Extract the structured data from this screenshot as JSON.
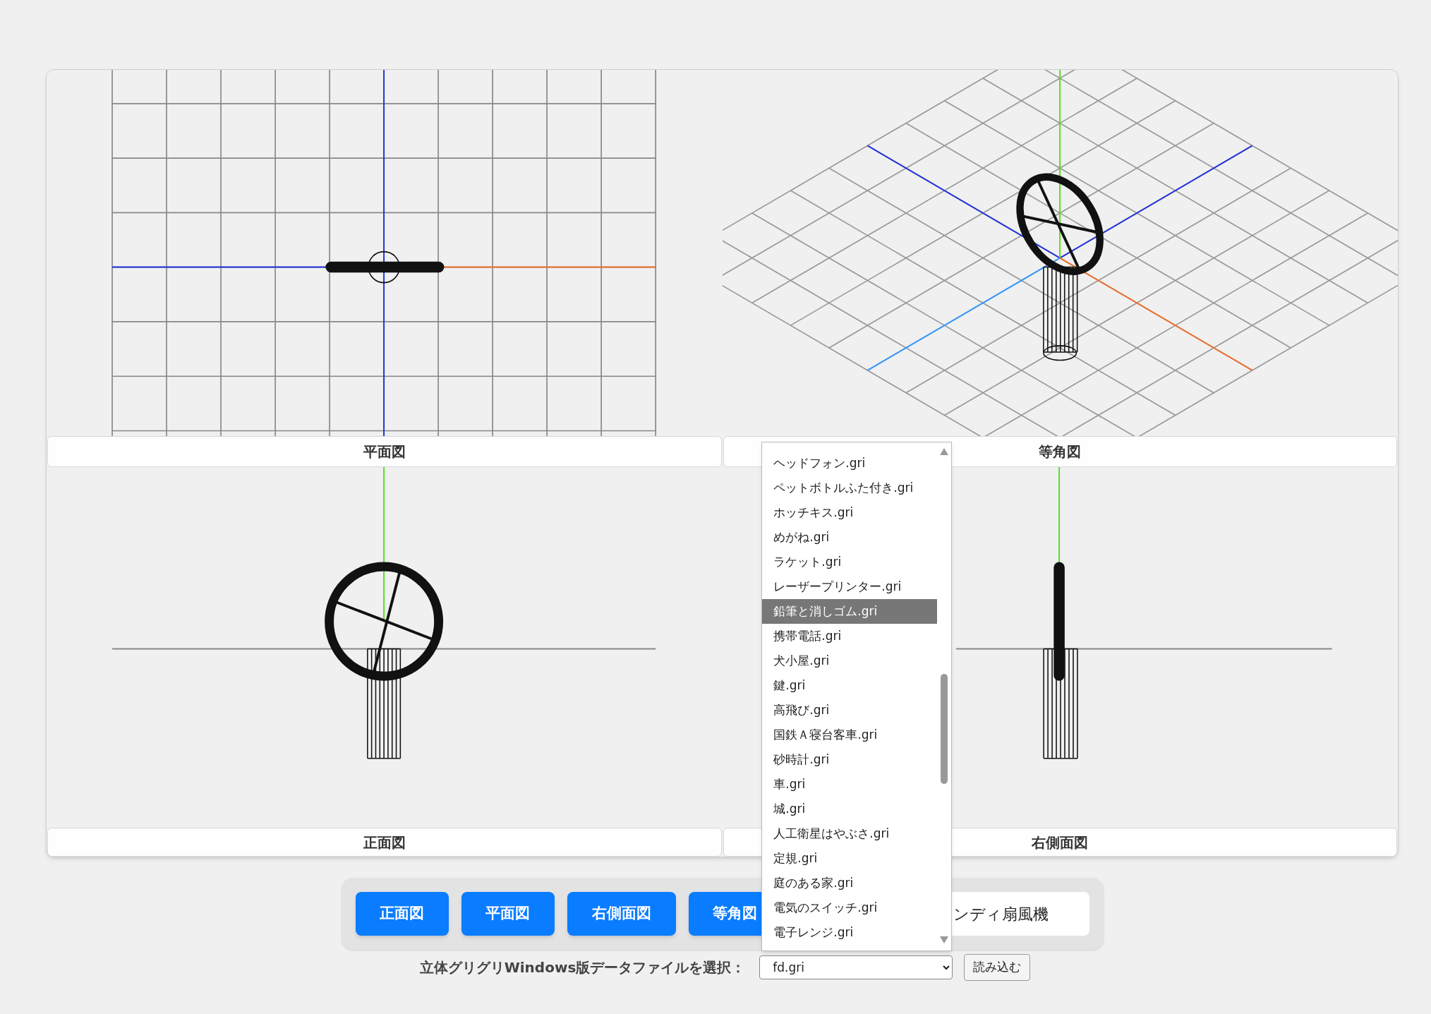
{
  "views": [
    {
      "label": "平面図",
      "kind": "plan"
    },
    {
      "label": "等角図",
      "kind": "iso"
    },
    {
      "label": "正面図",
      "kind": "front"
    },
    {
      "label": "右側面図",
      "kind": "side"
    }
  ],
  "toolbar": {
    "buttons": [
      "正面図",
      "平面図",
      "右側面図",
      "等角図"
    ],
    "model_name": "ンディ扇風機"
  },
  "file_picker": {
    "label": "立体グリグリWindows版データファイルを選択：",
    "value": "fd.gri",
    "load_button": "読み込む",
    "expanded": true,
    "options": [
      {
        "label": "ヘッドフォン.gri",
        "selected": false
      },
      {
        "label": "ペットボトルふた付き.gri",
        "selected": false
      },
      {
        "label": "ホッチキス.gri",
        "selected": false
      },
      {
        "label": "めがね.gri",
        "selected": false
      },
      {
        "label": "ラケット.gri",
        "selected": false
      },
      {
        "label": "レーザープリンター.gri",
        "selected": false
      },
      {
        "label": "鉛筆と消しゴム.gri",
        "selected": true
      },
      {
        "label": "携帯電話.gri",
        "selected": false
      },
      {
        "label": "犬小屋.gri",
        "selected": false
      },
      {
        "label": "鍵.gri",
        "selected": false
      },
      {
        "label": "高飛び.gri",
        "selected": false
      },
      {
        "label": "国鉄Ａ寝台客車.gri",
        "selected": false
      },
      {
        "label": "砂時計.gri",
        "selected": false
      },
      {
        "label": "車.gri",
        "selected": false
      },
      {
        "label": "城.gri",
        "selected": false
      },
      {
        "label": "人工衛星はやぶさ.gri",
        "selected": false
      },
      {
        "label": "定規.gri",
        "selected": false
      },
      {
        "label": "庭のある家.gri",
        "selected": false
      },
      {
        "label": "電気のスイッチ.gri",
        "selected": false
      },
      {
        "label": "電子レンジ.gri",
        "selected": false
      }
    ]
  }
}
